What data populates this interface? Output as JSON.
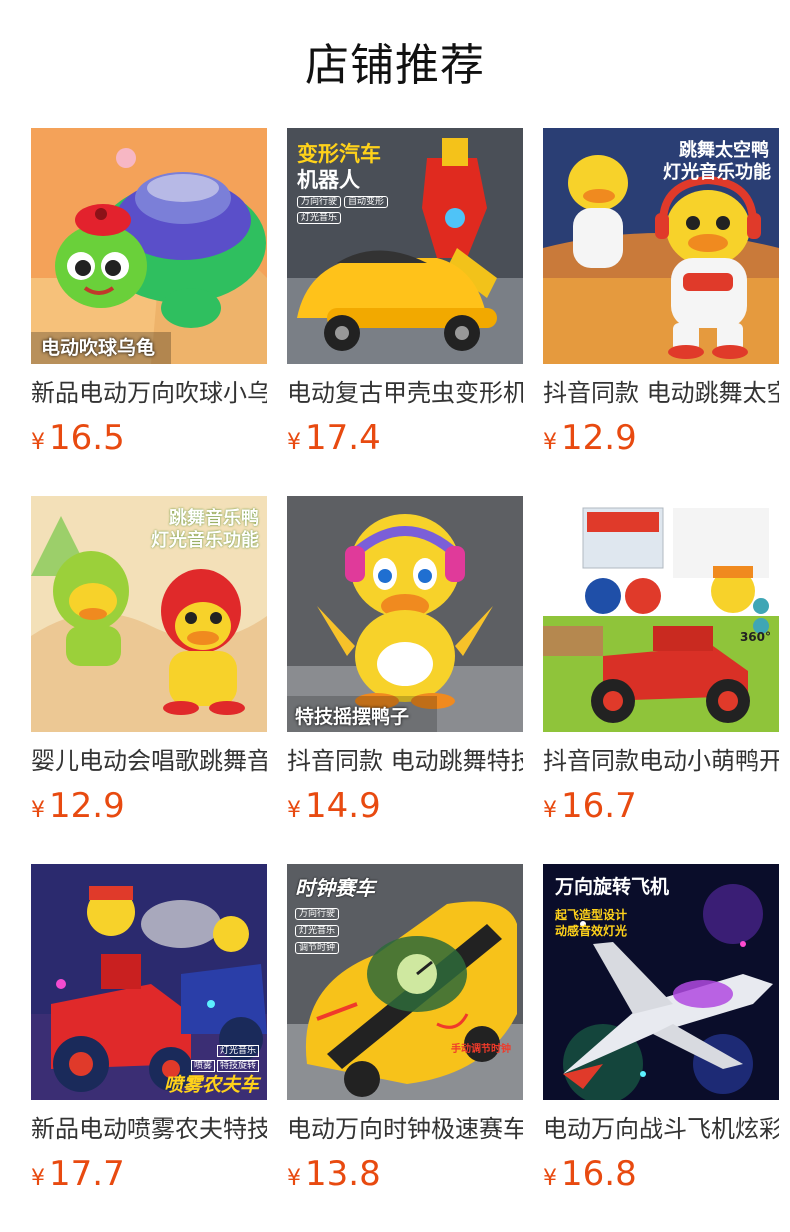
{
  "header": {
    "title": "店铺推荐"
  },
  "currency_symbol": "¥",
  "products": [
    {
      "name": "新品电动万向吹球小乌龟",
      "price": "16.5",
      "badge": "电动吹球乌龟",
      "icon": "toy-turtle"
    },
    {
      "name": "电动复古甲壳虫变形机器人",
      "price": "17.4",
      "badge": "变形汽车",
      "badge2": "机器人",
      "tags": [
        "万向行驶",
        "自动变形",
        "灯光音乐"
      ],
      "icon": "toy-transformer-car"
    },
    {
      "name": "抖音同款 电动跳舞太空鸭",
      "price": "12.9",
      "badge": "跳舞太空鸭",
      "badge2": "灯光音乐功能",
      "icon": "toy-space-duck"
    },
    {
      "name": "婴儿电动会唱歌跳舞音乐鸭",
      "price": "12.9",
      "badge": "跳舞音乐鸭",
      "badge2": "灯光音乐功能",
      "icon": "toy-music-duck"
    },
    {
      "name": "抖音同款 电动跳舞特技摇摆鸭子",
      "price": "14.9",
      "badge": "特技摇摆鸭子",
      "icon": "toy-swing-duck"
    },
    {
      "name": "抖音同款电动小萌鸭开车",
      "price": "16.7",
      "badge": "360°",
      "icon": "toy-duck-car"
    },
    {
      "name": "新品电动喷雾农夫特技车",
      "price": "17.7",
      "badge": "喷雾农夫车",
      "tags": [
        "灯光音乐",
        "喷雾",
        "特技旋转"
      ],
      "icon": "toy-spray-tractor"
    },
    {
      "name": "电动万向时钟极速赛车",
      "price": "13.8",
      "badge": "时钟赛车",
      "tags": [
        "万向行驶",
        "灯光音乐",
        "调节时钟"
      ],
      "badge2": "手动调节时钟",
      "icon": "toy-clock-race-car"
    },
    {
      "name": "电动万向战斗飞机炫彩灯光",
      "price": "16.8",
      "badge": "万向旋转飞机",
      "badge2": "起飞造型设计",
      "badge3": "动感音效灯光",
      "icon": "toy-fighter-plane"
    }
  ],
  "colors": {
    "price": "#e84a10",
    "title": "#111111",
    "name": "#333333"
  }
}
